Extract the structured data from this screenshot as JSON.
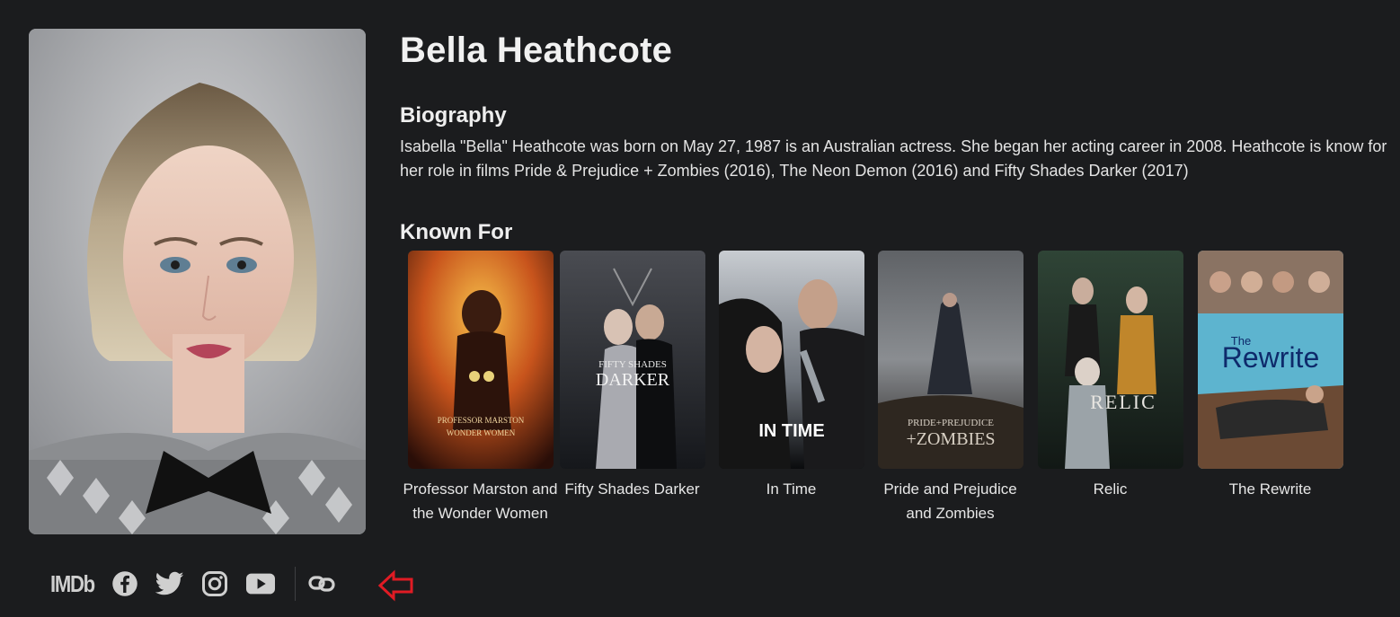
{
  "person": {
    "name": "Bella Heathcote",
    "portrait_alt": "Bella Heathcote portrait"
  },
  "biography": {
    "heading": "Biography",
    "text": "Isabella \"Bella\" Heathcote was born on May 27, 1987 is an Australian actress. She began her acting career in 2008. Heathcote is know for her role in films Pride & Prejudice + Zombies (2016), The Neon Demon (2016) and Fifty Shades Darker (2017)"
  },
  "known_for": {
    "heading": "Known For",
    "movies": [
      {
        "title": "Professor Marston and the Wonder Women",
        "poster_text": "PROFESSOR MARSTON\nWONDER WOMEN"
      },
      {
        "title": "Fifty Shades Darker",
        "poster_text": "FIFTY SHADES\nDARKER"
      },
      {
        "title": "In Time",
        "poster_text": "IN TIME"
      },
      {
        "title": "Pride and Prejudice and Zombies",
        "poster_text": "PRIDE+PREJUDICE\n+ZOMBIES"
      },
      {
        "title": "Relic",
        "poster_text": "RELIC"
      },
      {
        "title": "The Rewrite",
        "poster_text": "The\nRewrite"
      }
    ]
  },
  "socials": {
    "imdb_label": "IMDb",
    "icons": [
      "facebook-icon",
      "twitter-icon",
      "instagram-icon",
      "youtube-icon",
      "link-icon"
    ]
  },
  "colors": {
    "background": "#1b1c1e",
    "text": "#e6e6e6",
    "annotation_arrow": "#e01b24"
  }
}
